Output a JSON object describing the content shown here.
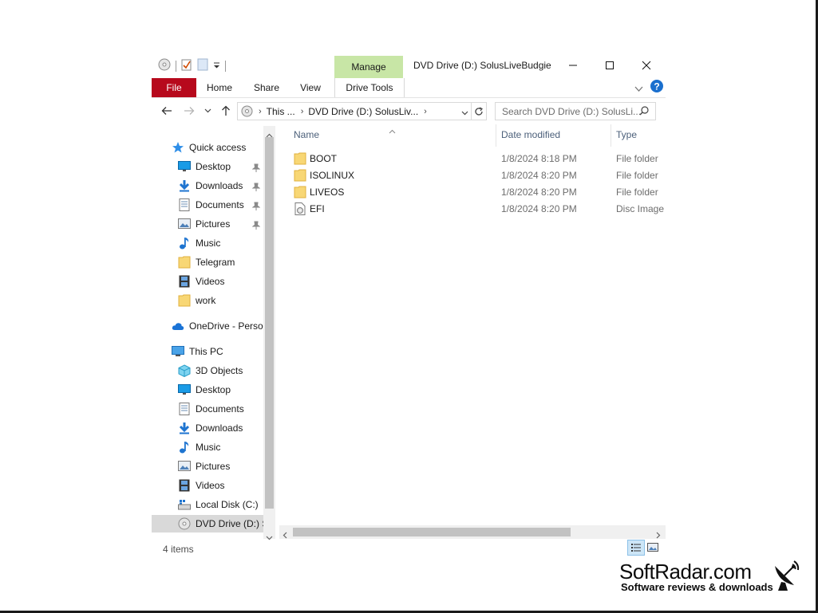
{
  "window": {
    "title": "DVD Drive (D:) SolusLiveBudgie",
    "context_tab": "Manage",
    "context_group": "Drive Tools"
  },
  "ribbon": {
    "tabs": [
      "File",
      "Home",
      "Share",
      "View"
    ],
    "drive_tools": "Drive Tools"
  },
  "address": {
    "crumbs": [
      "This ...",
      "DVD Drive (D:) SolusLiv..."
    ],
    "search_placeholder": "Search DVD Drive (D:) SolusLi..."
  },
  "nav": {
    "quick_access": {
      "label": "Quick access",
      "items": [
        {
          "label": "Desktop",
          "icon": "desktop-icon",
          "pinned": true
        },
        {
          "label": "Downloads",
          "icon": "downloads-icon",
          "pinned": true
        },
        {
          "label": "Documents",
          "icon": "documents-icon",
          "pinned": true
        },
        {
          "label": "Pictures",
          "icon": "pictures-icon",
          "pinned": true
        },
        {
          "label": "Music",
          "icon": "music-icon",
          "pinned": false
        },
        {
          "label": "Telegram",
          "icon": "folder-icon",
          "pinned": false
        },
        {
          "label": "Videos",
          "icon": "videos-icon",
          "pinned": false
        },
        {
          "label": "work",
          "icon": "folder-icon",
          "pinned": false
        }
      ]
    },
    "onedrive": "OneDrive - Persor",
    "this_pc": {
      "label": "This PC",
      "items": [
        {
          "label": "3D Objects",
          "icon": "3d-objects-icon"
        },
        {
          "label": "Desktop",
          "icon": "desktop-icon"
        },
        {
          "label": "Documents",
          "icon": "documents-icon"
        },
        {
          "label": "Downloads",
          "icon": "downloads-icon"
        },
        {
          "label": "Music",
          "icon": "music-icon"
        },
        {
          "label": "Pictures",
          "icon": "pictures-icon"
        },
        {
          "label": "Videos",
          "icon": "videos-icon"
        },
        {
          "label": "Local Disk (C:)",
          "icon": "local-disk-icon"
        },
        {
          "label": "DVD Drive (D:) Sc",
          "icon": "dvd-drive-icon",
          "selected": true
        }
      ]
    }
  },
  "columns": {
    "name": "Name",
    "date": "Date modified",
    "type": "Type"
  },
  "files": [
    {
      "name": "BOOT",
      "date": "1/8/2024 8:18 PM",
      "type": "File folder",
      "icon": "folder-icon"
    },
    {
      "name": "ISOLINUX",
      "date": "1/8/2024 8:20 PM",
      "type": "File folder",
      "icon": "folder-icon"
    },
    {
      "name": "LIVEOS",
      "date": "1/8/2024 8:20 PM",
      "type": "File folder",
      "icon": "folder-icon"
    },
    {
      "name": "EFI",
      "date": "1/8/2024 8:20 PM",
      "type": "Disc Image",
      "icon": "disc-image-icon"
    }
  ],
  "status": {
    "items_count": "4 items"
  },
  "watermark": {
    "brand": "SoftRadar.com",
    "tagline": "Software reviews & downloads"
  }
}
